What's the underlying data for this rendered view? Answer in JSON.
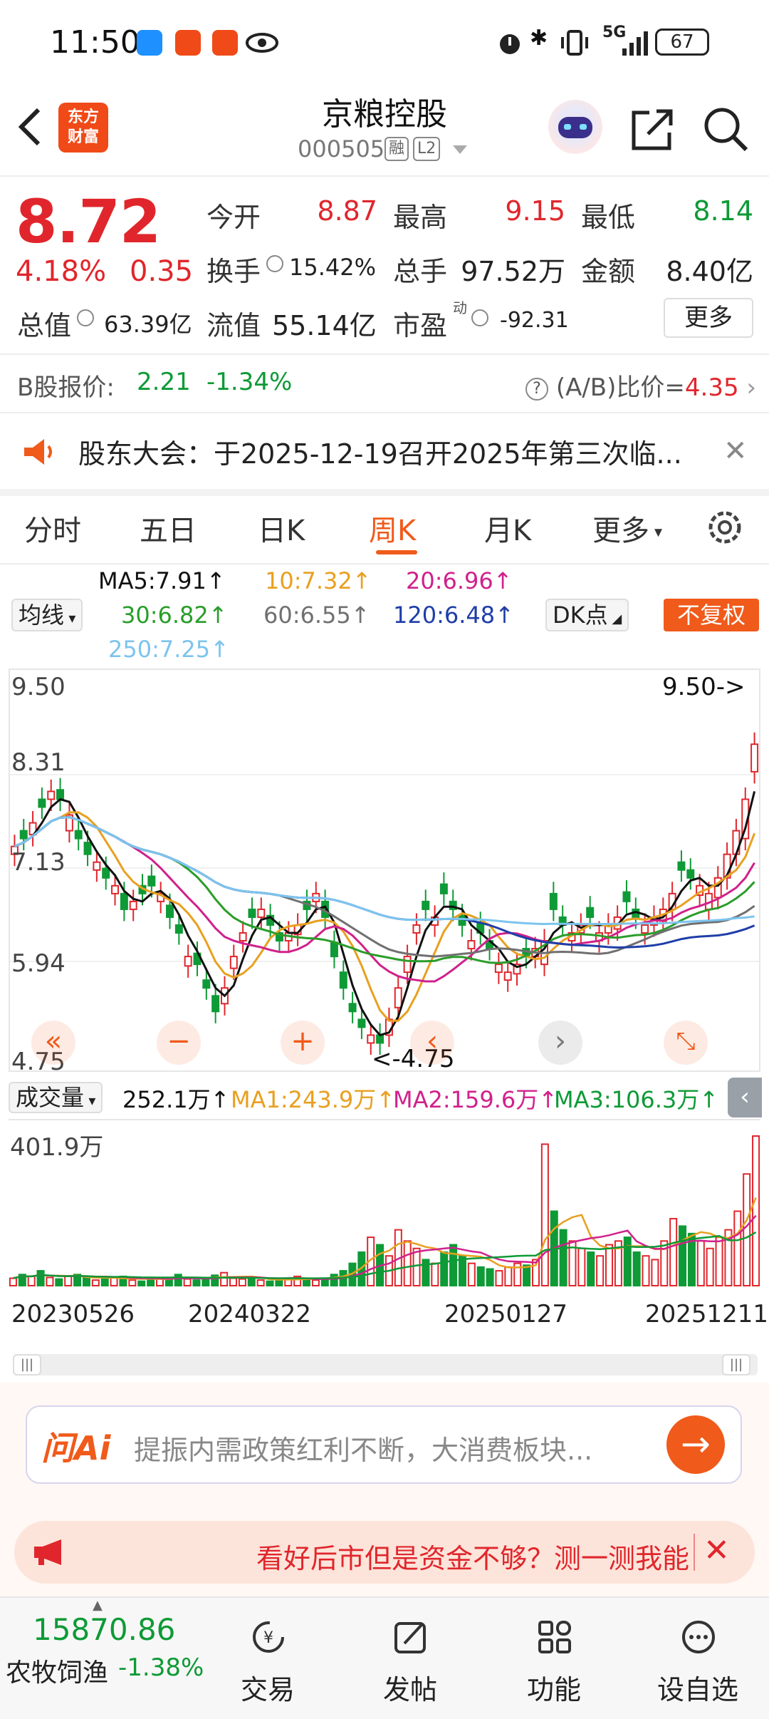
{
  "status_bar": {
    "time": "11:50",
    "network": "5G",
    "battery": "67",
    "app_icon_colors": [
      "#1e90ff",
      "#f04a18",
      "#f04a18"
    ]
  },
  "header": {
    "logo_text": "东方\n财富",
    "title": "京粮控股",
    "code": "000505",
    "tag_margin": "融",
    "tag_level": "L2"
  },
  "quote": {
    "price": "8.72",
    "change_pct": "4.18%",
    "change_val": "0.35",
    "open_label": "今开",
    "open": "8.87",
    "high_label": "最高",
    "high": "9.15",
    "low_label": "最低",
    "low": "8.14",
    "turnover_label": "换手",
    "turnover": "15.42%",
    "volume_label": "总手",
    "volume": "97.52万",
    "amount_label": "金额",
    "amount": "8.40亿",
    "mktcap_label": "总值",
    "mktcap": "63.39亿",
    "float_label": "流值",
    "float_cap": "55.14亿",
    "pe_label": "市盈",
    "pe_sup": "动",
    "pe": "-92.31",
    "more_label": "更多"
  },
  "bshare": {
    "label": "B股报价:",
    "price": "2.21",
    "pct": "-1.34%",
    "ratio_label": "(A/B)比价=",
    "ratio": "4.35"
  },
  "notice": {
    "text": "股东大会：于2025-12-19召开2025年第三次临..."
  },
  "tabs": [
    "分时",
    "五日",
    "日K",
    "周K",
    "月K",
    "更多"
  ],
  "active_tab": "周K",
  "ma_legend": {
    "ma5": "MA5:7.91↑",
    "ma10": "10:7.32↑",
    "ma20": "20:6.96↑",
    "ma30": "30:6.82↑",
    "ma60": "60:6.55↑",
    "ma120": "120:6.48↑",
    "ma250": "250:7.25↑",
    "indicator_select": "均线",
    "dk_select": "DK点",
    "adjust": "不复权"
  },
  "colors": {
    "up": "#e0262c",
    "down": "#0e9a36",
    "ma5": "#111111",
    "ma10": "#e8a020",
    "ma20": "#d0218c",
    "ma30": "#2a9d2a",
    "ma60": "#707070",
    "ma120": "#1f3ea8",
    "ma250": "#7cc4ee",
    "accent": "#f05a1a"
  },
  "chart_data": {
    "type": "candlestick",
    "period": "weekly",
    "y_ticks": [
      "9.50",
      "8.31",
      "7.13",
      "5.94",
      "4.75"
    ],
    "ylim": [
      4.75,
      9.5
    ],
    "max_marker": "9.50->",
    "min_marker": "<-4.75",
    "x_ticks": [
      "20230526",
      "20240322",
      "20250127",
      "20251211"
    ],
    "close": [
      7.4,
      7.5,
      7.7,
      7.9,
      8.1,
      8.0,
      7.8,
      7.5,
      7.3,
      7.2,
      7.0,
      6.9,
      6.6,
      6.7,
      6.8,
      6.9,
      6.8,
      6.5,
      6.3,
      6.0,
      5.9,
      5.6,
      5.3,
      5.6,
      6.0,
      6.3,
      6.5,
      6.6,
      6.4,
      6.2,
      6.3,
      6.4,
      6.6,
      6.8,
      6.5,
      6.0,
      5.6,
      5.3,
      5.1,
      5.0,
      4.9,
      5.2,
      5.6,
      6.0,
      6.4,
      6.6,
      6.5,
      6.8,
      6.6,
      6.4,
      6.2,
      6.3,
      6.1,
      5.9,
      5.8,
      5.9,
      6.0,
      6.1,
      6.2,
      6.6,
      6.4,
      6.3,
      6.4,
      6.5,
      6.3,
      6.4,
      6.5,
      6.7,
      6.5,
      6.4,
      6.5,
      6.6,
      6.8,
      7.1,
      7.0,
      6.9,
      6.8,
      7.0,
      7.3,
      7.6,
      8.0,
      8.7
    ],
    "open_delta": [
      -0.1,
      0.1,
      -0.15,
      0.1,
      -0.1,
      0.12,
      -0.2,
      0.1,
      0.15,
      -0.1,
      0.12,
      -0.1,
      0.2,
      -0.1,
      0.1,
      0.12,
      -0.1,
      0.15,
      0.1,
      -0.12,
      0.14,
      0.1,
      0.2,
      -0.2,
      -0.15,
      -0.1,
      0.1,
      -0.1,
      0.12,
      0.1,
      -0.1,
      -0.12,
      0.1,
      -0.1,
      0.2,
      0.18,
      0.2,
      0.1,
      0.1,
      -0.1,
      0.1,
      -0.2,
      -0.25,
      -0.2,
      -0.1,
      0.1,
      -0.1,
      0.12,
      0.1,
      0.12,
      -0.1,
      0.12,
      0.1,
      -0.1,
      -0.1,
      -0.12,
      0.1,
      -0.1,
      -0.3,
      0.2,
      0.1,
      -0.1,
      -0.1,
      0.12,
      -0.1,
      -0.1,
      -0.15,
      0.12,
      0.1,
      -0.1,
      -0.1,
      -0.15,
      -0.2,
      0.1,
      0.1,
      -0.12,
      -0.2,
      -0.25,
      -0.3,
      -0.3,
      -0.5,
      -0.35
    ],
    "volume_unit": "万",
    "volume_max_label": "401.9万",
    "volume": [
      20,
      30,
      25,
      40,
      22,
      18,
      25,
      30,
      20,
      15,
      18,
      22,
      25,
      15,
      12,
      18,
      20,
      22,
      30,
      18,
      15,
      20,
      28,
      35,
      20,
      18,
      22,
      15,
      12,
      14,
      18,
      25,
      20,
      15,
      18,
      30,
      40,
      60,
      90,
      130,
      110,
      80,
      150,
      120,
      100,
      70,
      60,
      90,
      110,
      80,
      60,
      50,
      45,
      40,
      50,
      60,
      55,
      70,
      380,
      200,
      150,
      120,
      100,
      90,
      80,
      110,
      120,
      130,
      90,
      80,
      70,
      120,
      180,
      160,
      140,
      120,
      100,
      130,
      150,
      200,
      300,
      401.9
    ]
  },
  "volume_legend": {
    "select": "成交量",
    "vol": "252.1万↑",
    "ma1": "MA1:243.9万↑",
    "ma2": "MA2:159.6万↑",
    "ma3": "MA3:106.3万↑"
  },
  "ai": {
    "logo": "问Ai",
    "text": "提振内需政策红利不断，大消费板块..."
  },
  "ad": {
    "text": "看好后市但是资金不够？测一测我能"
  },
  "bottom_nav": {
    "index_value": "15870.86",
    "index_name": "农牧饲渔",
    "index_change": "-1.38%",
    "items": [
      "交易",
      "发帖",
      "功能",
      "设自选"
    ]
  }
}
